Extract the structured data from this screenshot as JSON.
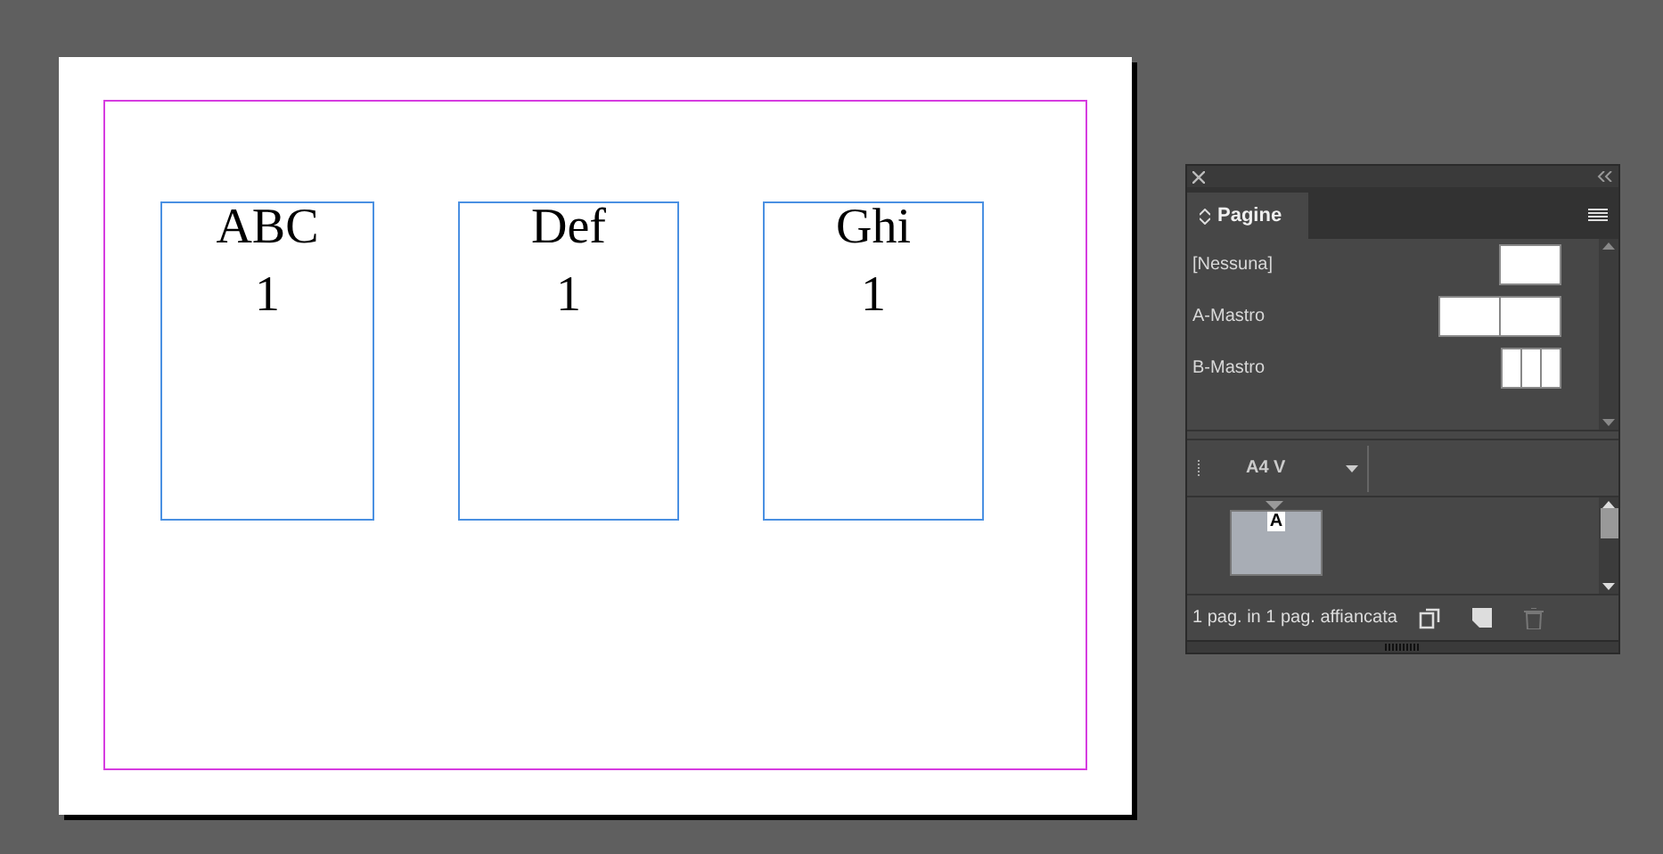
{
  "document": {
    "frames": [
      {
        "title": "ABC",
        "number": "1"
      },
      {
        "title": "Def",
        "number": "1"
      },
      {
        "title": "Ghi",
        "number": "1"
      }
    ]
  },
  "panel": {
    "tab": "Pagine",
    "masters": [
      {
        "label": "[Nessuna]",
        "kind": "single"
      },
      {
        "label": "A-Mastro",
        "kind": "spread"
      },
      {
        "label": "B-Mastro",
        "kind": "triple"
      }
    ],
    "size": "A4 V",
    "page_master": "A",
    "status": "1 pag. in 1 pag. affiancata"
  }
}
